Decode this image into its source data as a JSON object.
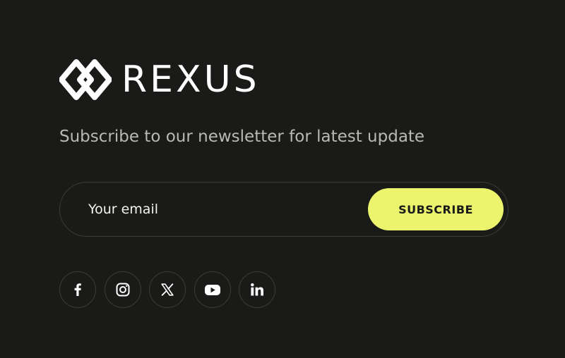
{
  "brand": {
    "name": "REXUS",
    "logo_icon": "interlocked-diamonds-icon"
  },
  "newsletter": {
    "tagline": "Subscribe to our newsletter for latest update",
    "email_placeholder": "Your email",
    "subscribe_label": "SUBSCRIBE"
  },
  "social_links": [
    {
      "name": "facebook",
      "icon": "facebook-icon"
    },
    {
      "name": "instagram",
      "icon": "instagram-icon"
    },
    {
      "name": "x",
      "icon": "x-icon"
    },
    {
      "name": "youtube",
      "icon": "youtube-icon"
    },
    {
      "name": "linkedin",
      "icon": "linkedin-icon"
    }
  ],
  "colors": {
    "background": "#1a1a18",
    "accent": "#ecf46d",
    "border": "#3b3b37",
    "muted_text": "#b9b9b4"
  }
}
